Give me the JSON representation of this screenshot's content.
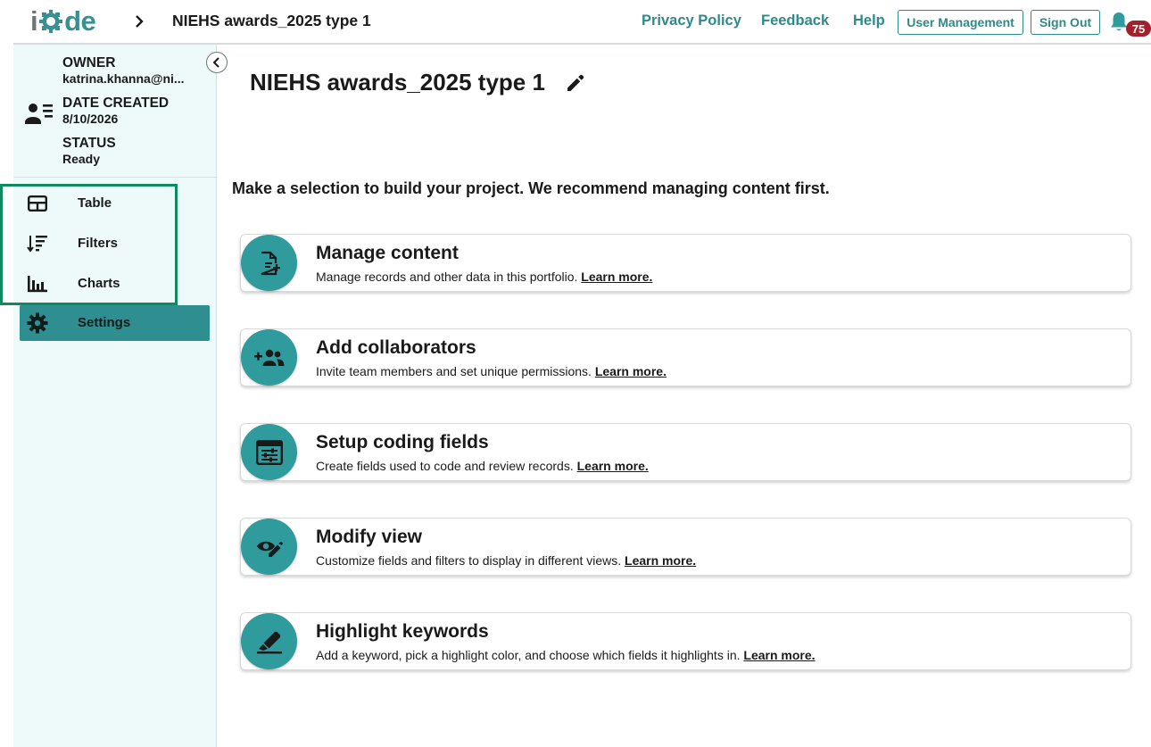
{
  "header": {
    "logo_text": "iCode",
    "breadcrumb_title": "NIEHS awards_2025 type 1",
    "links": {
      "privacy": "Privacy Policy",
      "feedback": "Feedback",
      "help": "Help"
    },
    "buttons": {
      "user_management": "User Management",
      "sign_out": "Sign Out"
    },
    "notification_count": "75"
  },
  "sidebar": {
    "owner_label": "OWNER",
    "owner_value": "katrina.khanna@ni...",
    "date_label": "DATE CREATED",
    "date_value": "8/10/2026",
    "status_label": "STATUS",
    "status_value": "Ready",
    "items": [
      {
        "label": "Table",
        "icon": "table-icon"
      },
      {
        "label": "Filters",
        "icon": "filter-sort-icon"
      },
      {
        "label": "Charts",
        "icon": "bar-chart-icon"
      },
      {
        "label": "Settings",
        "icon": "gear-icon"
      }
    ]
  },
  "main": {
    "title": "NIEHS awards_2025 type 1",
    "intro": "Make a selection to build your project. We recommend managing content first.",
    "cards": [
      {
        "title": "Manage content",
        "description": "Manage records and other data in this portfolio.",
        "link": "Learn more.",
        "icon": "document-add-icon"
      },
      {
        "title": "Add collaborators",
        "description": "Invite team members and set unique permissions.",
        "link": "Learn more.",
        "icon": "add-group-icon"
      },
      {
        "title": "Setup coding fields",
        "description": "Create fields used to code and review records.",
        "link": "Learn more.",
        "icon": "settings-window-icon"
      },
      {
        "title": "Modify view",
        "description": "Customize fields and filters to display in different views.",
        "link": "Learn more.",
        "icon": "eye-pencil-icon"
      },
      {
        "title": "Highlight keywords",
        "description": "Add a keyword, pick a highlight color, and choose which fields it highlights in.",
        "link": "Learn more.",
        "icon": "highlighter-icon"
      }
    ]
  },
  "colors": {
    "accent": "#2f8a8b",
    "circle": "#2f9b9c",
    "sidebar_bg": "#eefafa",
    "active_item": "#2f8f90",
    "badge": "#a3212b",
    "highlight_box": "#0f8a5f"
  }
}
